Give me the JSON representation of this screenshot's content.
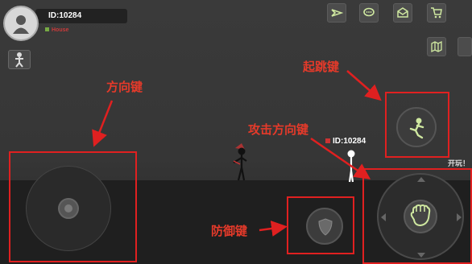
{
  "hud": {
    "player_id": "ID:10284",
    "house": "House",
    "play_text": "开玩！"
  },
  "character": {
    "name_tag": "ID:10284"
  },
  "annotations": {
    "direction": "方向键",
    "jump": "起跳键",
    "attack_direction": "攻击方向键",
    "defend": "防御键"
  },
  "top_icons": [
    "boomerang-icon",
    "chat-icon",
    "envelope-icon",
    "cart-icon",
    "map-icon"
  ],
  "colors": {
    "annotation_red": "#e02020"
  }
}
